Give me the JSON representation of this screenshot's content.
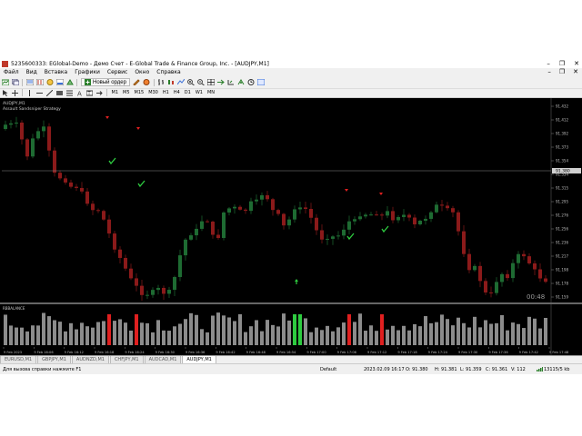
{
  "window": {
    "title": "5235600333: EGlobal-Demo - Демо Счет - E-Global Trade & Finance Group, Inc. - [AUDJPY,M1]",
    "controls": [
      "–",
      "❐",
      "✕"
    ]
  },
  "menu": [
    "Файл",
    "Вид",
    "Вставка",
    "Графики",
    "Сервис",
    "Окно",
    "Справка"
  ],
  "toolbar": {
    "new_order_label": "Новый ордер"
  },
  "timeframes": [
    "M1",
    "M5",
    "M15",
    "M30",
    "H1",
    "H4",
    "D1",
    "W1",
    "MN"
  ],
  "chart": {
    "symbol_label": "AUDJPY,M1",
    "indicator_label": "Assault Sandsniper Strategy",
    "sub_label": "RBBALANCE",
    "countdown": "00:48",
    "price_ticks": [
      "91.432",
      "91.412",
      "91.392",
      "91.373",
      "91.354",
      "91.334",
      "91.315",
      "91.295",
      "91.276",
      "91.256",
      "91.236",
      "91.217",
      "91.198",
      "91.178",
      "91.159"
    ],
    "price_tag": "91.380",
    "time_ticks": [
      "9 Feb 2023",
      "9 Feb 16:06",
      "9 Feb 16:12",
      "9 Feb 16:18",
      "9 Feb 16:24",
      "9 Feb 16:30",
      "9 Feb 16:36",
      "9 Feb 16:42",
      "9 Feb 16:48",
      "9 Feb 16:54",
      "9 Feb 17:00",
      "9 Feb 17:06",
      "9 Feb 17:12",
      "9 Feb 17:18",
      "9 Feb 17:24",
      "9 Feb 17:30",
      "9 Feb 17:36",
      "9 Feb 17:42",
      "9 Feb 17:48"
    ],
    "colors": {
      "bull": "#1e6b32",
      "bear": "#8b1a1a",
      "signal": "#2ecc40",
      "sell_signal": "#e02020",
      "volume": "#8c8c8c"
    }
  },
  "tabs": [
    "EURUSD,M1",
    "GBPJPY,M1",
    "AUDNZD,M1",
    "CHFJPY,M1",
    "AUDCAD,M1",
    "AUDJPY,M1"
  ],
  "active_tab": 5,
  "status": {
    "help": "Для вызова справки нажмите F1",
    "profile": "Default",
    "datetime": "2023.02.09 16:17",
    "open": "O: 91.380",
    "high": "H: 91.381",
    "low": "L: 91.359",
    "close": "C: 91.361",
    "volume": "V: 112",
    "traffic": "13115/5 kb"
  }
}
